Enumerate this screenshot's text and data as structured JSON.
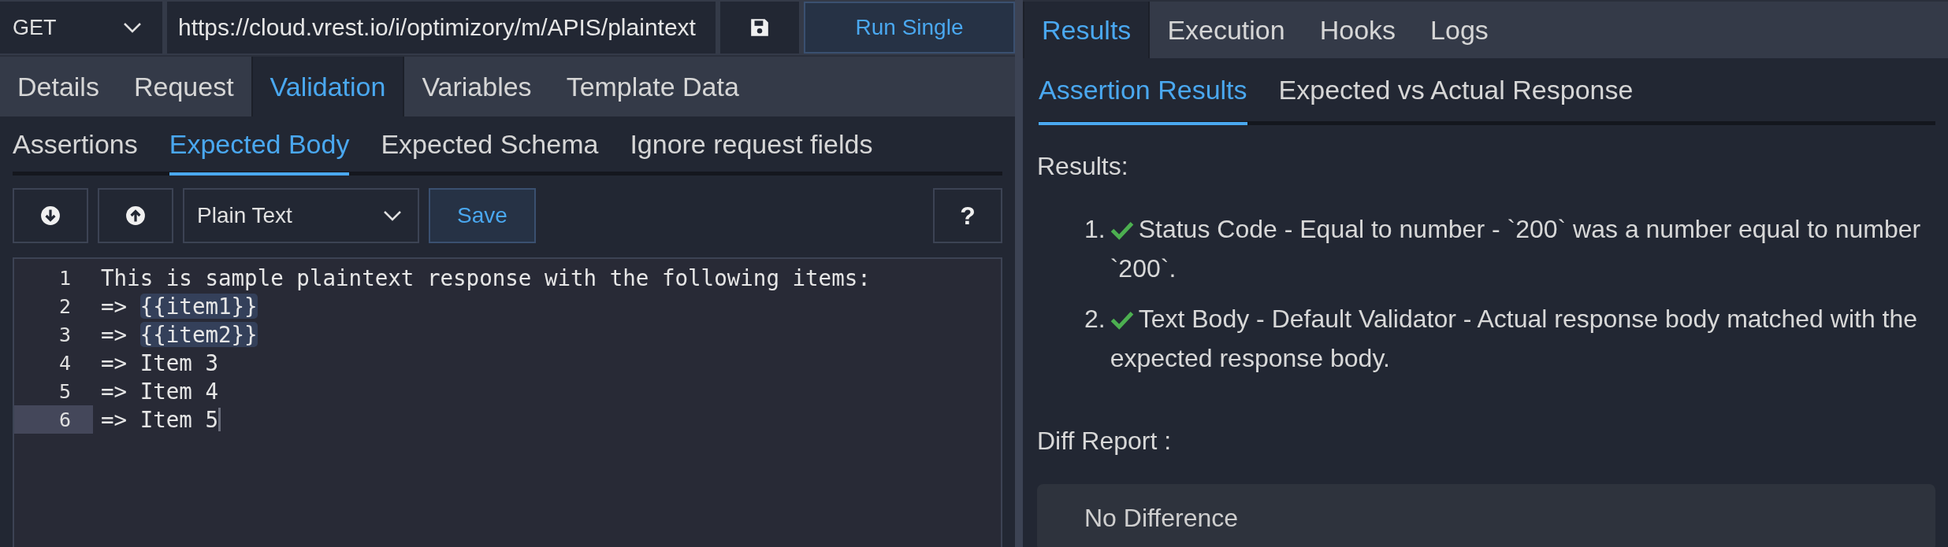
{
  "request_bar": {
    "method": "GET",
    "url": "https://cloud.vrest.io/i/optimizory/m/APIS/plaintext",
    "run_button": "Run Single"
  },
  "tabs": [
    {
      "label": "Details",
      "selected": false
    },
    {
      "label": "Request",
      "selected": false
    },
    {
      "label": "Validation",
      "selected": true
    },
    {
      "label": "Variables",
      "selected": false
    },
    {
      "label": "Template Data",
      "selected": false
    }
  ],
  "sub_tabs": [
    {
      "label": "Assertions",
      "selected": false
    },
    {
      "label": "Expected Body",
      "selected": true
    },
    {
      "label": "Expected Schema",
      "selected": false
    },
    {
      "label": "Ignore request fields",
      "selected": false
    }
  ],
  "toolbar": {
    "body_type": "Plain Text",
    "save_button": "Save",
    "help_button": "?"
  },
  "editor": {
    "lines": [
      {
        "number": "1",
        "active": false,
        "segments": [
          {
            "text": "This is sample plaintext response with the following items:",
            "kind": "plain"
          }
        ]
      },
      {
        "number": "2",
        "active": false,
        "segments": [
          {
            "text": "=> ",
            "kind": "plain"
          },
          {
            "text": "{{item1}}",
            "kind": "template"
          }
        ]
      },
      {
        "number": "3",
        "active": false,
        "segments": [
          {
            "text": "=> ",
            "kind": "plain"
          },
          {
            "text": "{{item2}}",
            "kind": "template"
          }
        ]
      },
      {
        "number": "4",
        "active": false,
        "segments": [
          {
            "text": "=> Item 3",
            "kind": "plain"
          }
        ]
      },
      {
        "number": "5",
        "active": false,
        "segments": [
          {
            "text": "=> Item 4",
            "kind": "plain"
          }
        ]
      },
      {
        "number": "6",
        "active": true,
        "segments": [
          {
            "text": "=> Item 5",
            "kind": "plain"
          }
        ]
      }
    ]
  },
  "result_tabs": [
    {
      "label": "Results",
      "selected": true
    },
    {
      "label": "Execution",
      "selected": false
    },
    {
      "label": "Hooks",
      "selected": false
    },
    {
      "label": "Logs",
      "selected": false
    }
  ],
  "result_sub_tabs": [
    {
      "label": "Assertion Results",
      "selected": true
    },
    {
      "label": "Expected vs Actual Response",
      "selected": false
    }
  ],
  "results": {
    "heading": "Results:",
    "items": [
      {
        "number": "1.",
        "passed": true,
        "text": "Status Code - Equal to number - `200` was a number equal to number `200`."
      },
      {
        "number": "2.",
        "passed": true,
        "text": "Text Body - Default Validator - Actual response body matched with the expected response body."
      }
    ],
    "diff_heading": "Diff Report :",
    "diff_text": "No Difference"
  }
}
